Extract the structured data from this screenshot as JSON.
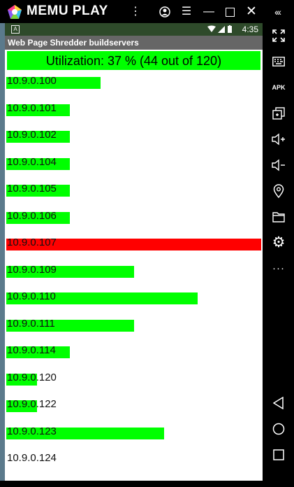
{
  "emulator": {
    "brand": "MEMU PLAY",
    "controls": [
      "more-vert",
      "account",
      "menu",
      "minimize",
      "maximize",
      "close",
      "collapse"
    ]
  },
  "statusbar": {
    "notification": "A",
    "time": "4:35"
  },
  "app": {
    "title": "Web Page Shredder buildservers",
    "utilization_text": "Utilization: 37 % (44 out of 120)"
  },
  "servers": [
    {
      "ip": "10.9.0.100",
      "load": 0.37,
      "status": "ok"
    },
    {
      "ip": "10.9.0.101",
      "load": 0.25,
      "status": "ok"
    },
    {
      "ip": "10.9.0.102",
      "load": 0.25,
      "status": "ok"
    },
    {
      "ip": "10.9.0.104",
      "load": 0.25,
      "status": "ok"
    },
    {
      "ip": "10.9.0.105",
      "load": 0.25,
      "status": "ok"
    },
    {
      "ip": "10.9.0.106",
      "load": 0.25,
      "status": "ok"
    },
    {
      "ip": "10.9.0.107",
      "load": 1.0,
      "status": "full"
    },
    {
      "ip": "10.9.0.109",
      "load": 0.5,
      "status": "ok"
    },
    {
      "ip": "10.9.0.110",
      "load": 0.75,
      "status": "ok"
    },
    {
      "ip": "10.9.0.111",
      "load": 0.5,
      "status": "ok"
    },
    {
      "ip": "10.9.0.114",
      "load": 0.25,
      "status": "ok"
    },
    {
      "ip": "10.9.0.120",
      "load": 0.12,
      "status": "ok"
    },
    {
      "ip": "10.9.0.122",
      "load": 0.12,
      "status": "ok"
    },
    {
      "ip": "10.9.0.123",
      "load": 0.62,
      "status": "ok"
    },
    {
      "ip": "10.9.0.124",
      "load": 0.0,
      "status": "ok"
    }
  ],
  "colors": {
    "ok": "#00ff00",
    "full": "#ff0000"
  },
  "side_panel": [
    "fullscreen",
    "keyboard",
    "apk",
    "multi-window",
    "volume-up",
    "volume-down",
    "location",
    "folder",
    "settings",
    "more",
    "back",
    "home",
    "recents"
  ]
}
